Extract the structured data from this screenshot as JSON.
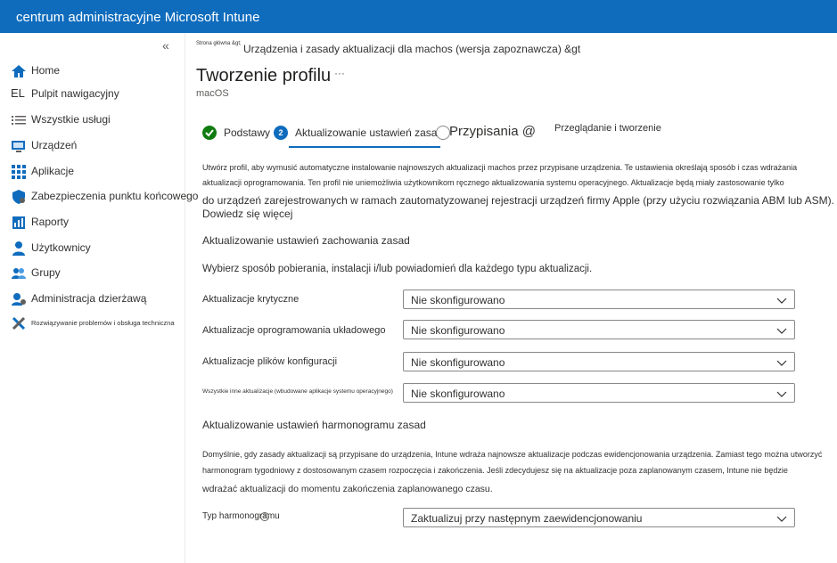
{
  "header": {
    "title": "centrum administracyjne Microsoft Intune"
  },
  "sidebar": {
    "collapse_glyph": "«",
    "items": [
      {
        "label": "Home",
        "icon": "home-icon"
      },
      {
        "label": "Pulpit nawigacyjny",
        "icon_text": "EL"
      },
      {
        "label": "Wszystkie usługi",
        "icon": "list-icon"
      },
      {
        "label": "Urządzeń",
        "icon": "devices-icon"
      },
      {
        "label": "Aplikacje",
        "icon": "apps-grid-icon"
      },
      {
        "label": "Zabezpieczenia punktu końcowego",
        "icon": "shield-icon"
      },
      {
        "label": "Raporty",
        "icon": "reports-icon"
      },
      {
        "label": "Użytkownicy",
        "icon": "user-icon"
      },
      {
        "label": "Grupy",
        "icon": "groups-icon"
      },
      {
        "label": "Administracja dzierżawą",
        "icon": "tenant-admin-icon"
      },
      {
        "label": "Rozwiązywanie problemów i obsługa techniczna",
        "icon": "troubleshoot-icon"
      }
    ]
  },
  "breadcrumb": {
    "home": "Strona główna &gt;",
    "path": "Urządzenia i zasady aktualizacji dla machos (wersja zapoznawcza) &gt"
  },
  "page": {
    "title": "Tworzenie profilu",
    "ellipsis": "···",
    "subtitle": "macOS"
  },
  "steps": [
    {
      "label": "Podstawy",
      "state": "done"
    },
    {
      "number": "2",
      "label": "Aktualizowanie ustawień zasad",
      "state": "active"
    },
    {
      "label": "Przypisania @",
      "state": "pending"
    },
    {
      "label": "Przeglądanie i tworzenie",
      "state": "pending"
    }
  ],
  "intro": {
    "line1": "Utwórz profil, aby wymusić automatyczne instalowanie najnowszych aktualizacji machos przez przypisane urządzenia. Te ustawienia określają sposób i czas wdrażania",
    "line2": "aktualizacji oprogramowania. Ten profil nie uniemożliwia użytkownikom ręcznego aktualizowania systemu operacyjnego. Aktualizacje będą miały zastosowanie tylko",
    "line3": "do urządzeń zarejestrowanych w ramach zautomatyzowanej rejestracji urządzeń firmy Apple (przy użyciu rozwiązania ABM lub ASM).",
    "learn_more": "Dowiedz się więcej"
  },
  "behavior": {
    "heading": "Aktualizowanie ustawień zachowania zasad",
    "description": "Wybierz sposób pobierania, instalacji i/lub powiadomień dla każdego typu aktualizacji.",
    "rows": [
      {
        "label": "Aktualizacje krytyczne",
        "value": "Nie skonfigurowano"
      },
      {
        "label": "Aktualizacje oprogramowania układowego",
        "value": "Nie skonfigurowano"
      },
      {
        "label": "Aktualizacje plików konfiguracji",
        "value": "Nie skonfigurowano"
      },
      {
        "label": "Wszystkie inne aktualizacje (wbudowane aplikacje systemu operacyjnego)",
        "value": "Nie skonfigurowano"
      }
    ]
  },
  "schedule": {
    "heading": "Aktualizowanie ustawień harmonogramu zasad",
    "line1": "Domyślnie, gdy zasady aktualizacji są przypisane do urządzenia, Intune wdraża najnowsze aktualizacje podczas ewidencjonowania urządzenia. Zamiast tego można utworzyć",
    "line2": "harmonogram tygodniowy z dostosowanym czasem rozpoczęcia i zakończenia. Jeśli zdecydujesz się na aktualizacje poza zaplanowanym czasem, Intune nie będzie",
    "line3": "wdrażać aktualizacji do momentu zakończenia zaplanowanego czasu.",
    "type_label": "Typ harmonogramu",
    "type_value": "Zaktualizuj przy następnym zaewidencjonowaniu"
  },
  "colors": {
    "brand": "#0f6cbd",
    "success": "#107c10"
  }
}
